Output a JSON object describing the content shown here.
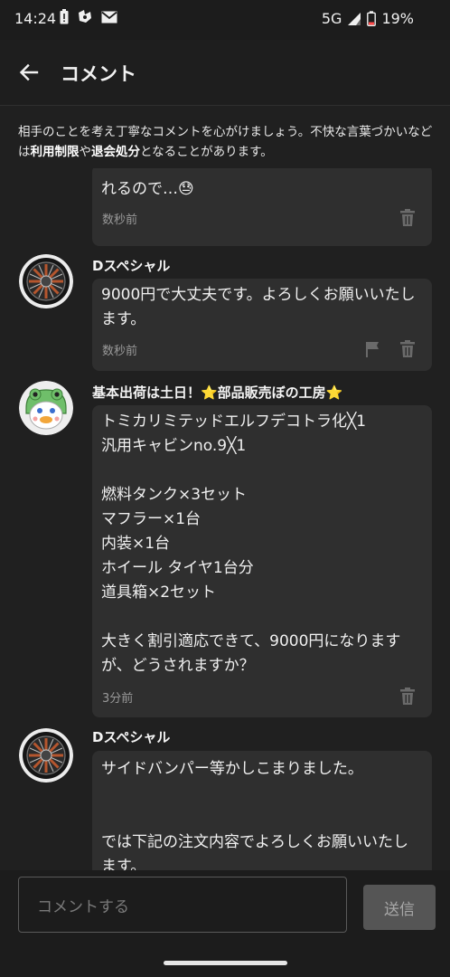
{
  "status_bar": {
    "time": "14:24",
    "network": "5G",
    "battery": "19%",
    "left_icons": [
      "battery-alert-icon",
      "app-notification-icon",
      "mail-icon"
    ]
  },
  "header": {
    "title": "コメント",
    "back_icon": "arrow-back-icon"
  },
  "notice": {
    "part1": "相手のことを考え丁寧なコメントを心がけましょう。不快な言葉づかいなどは",
    "bold1": "利用制限",
    "part2": "や",
    "bold2": "退会処分",
    "part3": "となることがあります。"
  },
  "comments": [
    {
      "user": "",
      "text": "れるので…😓",
      "time": "数秒前",
      "actions": [
        "trash-icon"
      ]
    },
    {
      "user": "Dスペシャル",
      "text": "9000円で大丈夫です。よろしくお願いいたします。",
      "time": "数秒前",
      "actions": [
        "flag-icon",
        "trash-icon"
      ]
    },
    {
      "user": "基本出荷は土日！⭐部品販売ぼの工房⭐",
      "text": "トミカリミテッドエルフデコトラ化╳1\n汎用キャビンno.9╳1\n\n燃料タンク×3セット\nマフラー×1台\n内装×1台\nホイール タイヤ1台分\n道具箱×2セット\n\n大きく割引適応できて、9000円になりますが、どうされますか？",
      "time": "3分前",
      "actions": [
        "trash-icon"
      ]
    },
    {
      "user": "Dスペシャル",
      "text": "サイドバンパー等かしこまりました。\n\n\nでは下記の注文内容でよろしくお願いいたします。",
      "time": "",
      "actions": []
    }
  ],
  "composer": {
    "placeholder": "コメントする",
    "send_label": "送信"
  },
  "colors": {
    "background": "#202020",
    "bubble": "#2f2f2f",
    "send_button": "#555555"
  }
}
